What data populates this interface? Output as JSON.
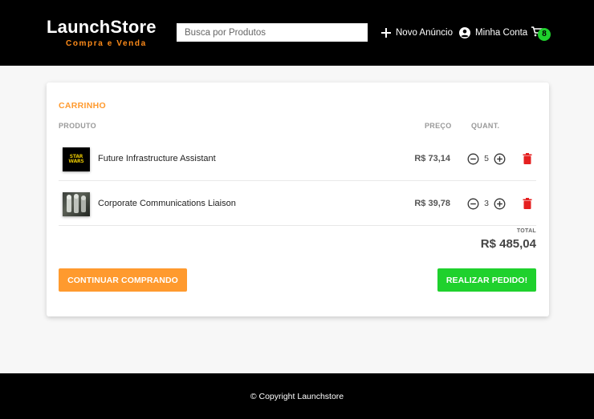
{
  "header": {
    "logo_title": "LaunchStore",
    "logo_subtitle": "Compra e Venda",
    "search_placeholder": "Busca por Produtos",
    "new_ad_label": "Novo Anúncio",
    "account_label": "Minha Conta",
    "cart_count": "8"
  },
  "cart": {
    "title": "CARRINHO",
    "col_product": "PRODUTO",
    "col_price": "PREÇO",
    "col_quantity": "QUANT.",
    "items": [
      {
        "name": "Future Infrastructure Assistant",
        "price": "R$ 73,14",
        "quantity": "5",
        "thumb": "star-wars-logo"
      },
      {
        "name": "Corporate Communications Liaison",
        "price": "R$ 39,78",
        "quantity": "3",
        "thumb": "stormtroopers-image"
      }
    ],
    "total_label": "TOTAL",
    "total_value": "R$ 485,04",
    "continue_label": "CONTINUAR COMPRANDO",
    "order_label": "REALIZAR PEDIDO!"
  },
  "footer": {
    "copyright": "© Copyright Launchstore"
  },
  "colors": {
    "accent_orange": "#ff9a2e",
    "accent_green": "#1fd12d",
    "header_bg": "#000000",
    "trash_red": "#e52020"
  },
  "icons": {
    "new_ad": "plus-icon",
    "account": "account-circle-icon",
    "cart": "shopping-cart-icon",
    "decrease": "minus-circle-icon",
    "increase": "plus-circle-icon",
    "remove": "trash-icon"
  }
}
